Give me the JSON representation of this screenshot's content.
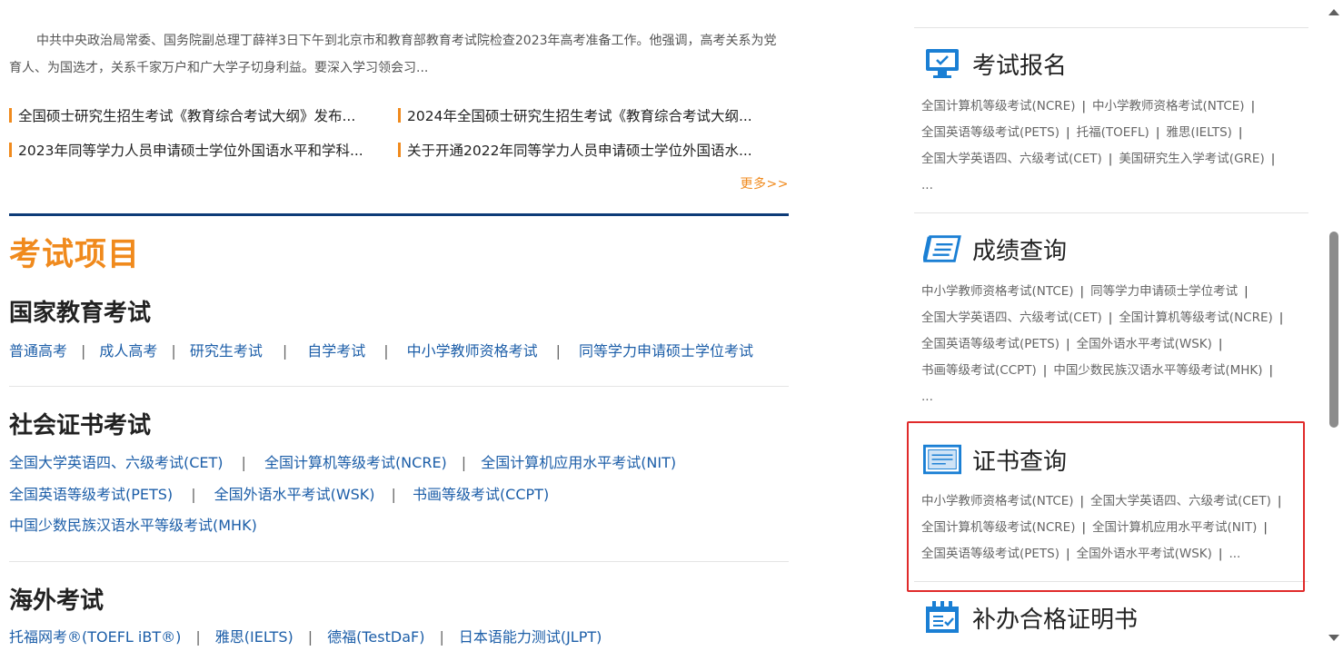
{
  "intro": {
    "text": "中共中央政治局常委、国务院副总理丁薛祥3日下午到北京市和教育部教育考试院检查2023年高考准备工作。他强调，高考关系为党育人、为国选才，关系千家万户和广大学子切身利益。要深入学习领会习..."
  },
  "news": [
    "全国硕士研究生招生考试《教育综合考试大纲》发布...",
    "2024年全国硕士研究生招生考试《教育综合考试大纲...",
    "2023年同等学力人员申请硕士学位外国语水平和学科...",
    "关于开通2022年同等学力人员申请硕士学位外国语水..."
  ],
  "more_label": "更多>>",
  "section_title": "考试项目",
  "categories": [
    {
      "title": "国家教育考试",
      "rows": [
        [
          "普通高考",
          "成人高考",
          "研究生考试",
          "自学考试",
          "中小学教师资格考试",
          "同等学力申请硕士学位考试"
        ]
      ]
    },
    {
      "title": "社会证书考试",
      "rows": [
        [
          "全国大学英语四、六级考试(CET)",
          "全国计算机等级考试(NCRE)",
          "全国计算机应用水平考试(NIT)"
        ],
        [
          "全国英语等级考试(PETS)",
          "全国外语水平考试(WSK)",
          "书画等级考试(CCPT)"
        ],
        [
          "中国少数民族汉语水平等级考试(MHK)"
        ]
      ]
    },
    {
      "title": "海外考试",
      "rows": [
        [
          "托福网考®(TOEFL iBT®)",
          "雅思(IELTS)",
          "德福(TestDaF)",
          "日本语能力测试(JLPT)"
        ]
      ]
    }
  ],
  "sidebar": {
    "registration": {
      "title": "考试报名",
      "icon": "monitor-icon",
      "lines": [
        [
          "全国计算机等级考试(NCRE)",
          "中小学教师资格考试(NTCE)"
        ],
        [
          "全国英语等级考试(PETS)",
          "托福(TOEFL)",
          "雅思(IELTS)"
        ],
        [
          "全国大学英语四、六级考试(CET)",
          "美国研究生入学考试(GRE)"
        ]
      ],
      "ellipsis": "..."
    },
    "scores": {
      "title": "成绩查询",
      "icon": "score-report-icon",
      "lines": [
        [
          "中小学教师资格考试(NTCE)",
          "同等学力申请硕士学位考试"
        ],
        [
          "全国大学英语四、六级考试(CET)",
          "全国计算机等级考试(NCRE)"
        ],
        [
          "全国英语等级考试(PETS)",
          "全国外语水平考试(WSK)"
        ],
        [
          "书画等级考试(CCPT)",
          "中国少数民族汉语水平等级考试(MHK)"
        ]
      ],
      "ellipsis": "..."
    },
    "certificates": {
      "title": "证书查询",
      "icon": "certificate-icon",
      "lines": [
        [
          "中小学教师资格考试(NTCE)",
          "全国大学英语四、六级考试(CET)"
        ],
        [
          "全国计算机等级考试(NCRE)",
          "全国计算机应用水平考试(NIT)"
        ],
        [
          "全国英语等级考试(PETS)",
          "全国外语水平考试(WSK)"
        ]
      ],
      "ellipsis": "..."
    },
    "reissue": {
      "title": "补办合格证明书",
      "icon": "calendar-check-icon"
    }
  },
  "colors": {
    "accent_orange": "#f08a1d",
    "link_blue": "#1c5ea8",
    "navy_rule": "#0d3b78",
    "highlight_red": "#e02a2a"
  }
}
